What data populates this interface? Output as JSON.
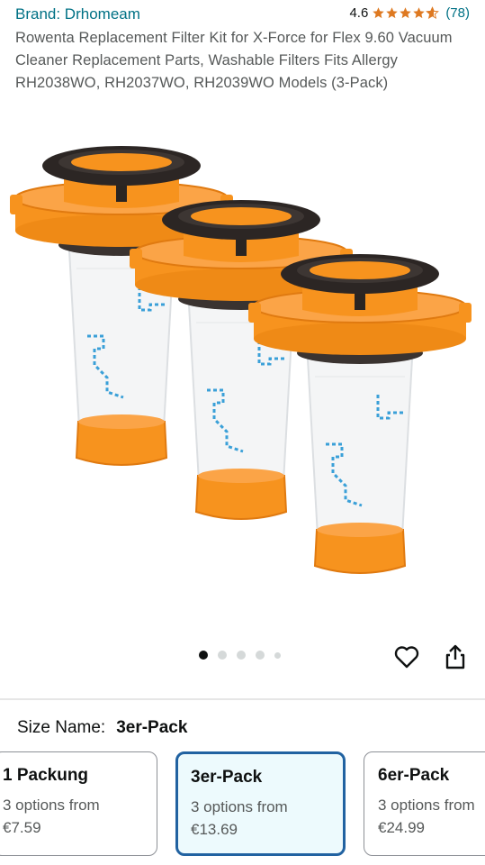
{
  "header": {
    "brand": "Brand: Drhomeam",
    "rating": "4.6",
    "stars": 4.6,
    "review_count": "(78)",
    "title": "Rowenta Replacement Filter Kit for X-Force for Flex 9.60 Vacuum Cleaner Replacement Parts, Washable Filters Fits Allergy RH2038WO, RH2037WO, RH2039WO Models (3-Pack)"
  },
  "gallery": {
    "image_alt": "three orange and white replacement filters",
    "dot_count": 5,
    "active_dot": 0,
    "icons": [
      "heart-icon",
      "share-icon"
    ]
  },
  "variation": {
    "label": "Size Name:",
    "selected": "3er-Pack",
    "options": [
      {
        "name": "1 Packung",
        "sub": "3 options from",
        "price": "€7.59"
      },
      {
        "name": "3er-Pack",
        "sub": "3 options from",
        "price": "€13.69"
      },
      {
        "name": "6er-Pack",
        "sub": "3 options from",
        "price": "€24.99"
      }
    ]
  },
  "colors": {
    "link": "#007185",
    "star": "#de7921",
    "selected_border": "#2162a1",
    "selected_bg": "#edfafd",
    "filter_orange": "#f7931e"
  }
}
